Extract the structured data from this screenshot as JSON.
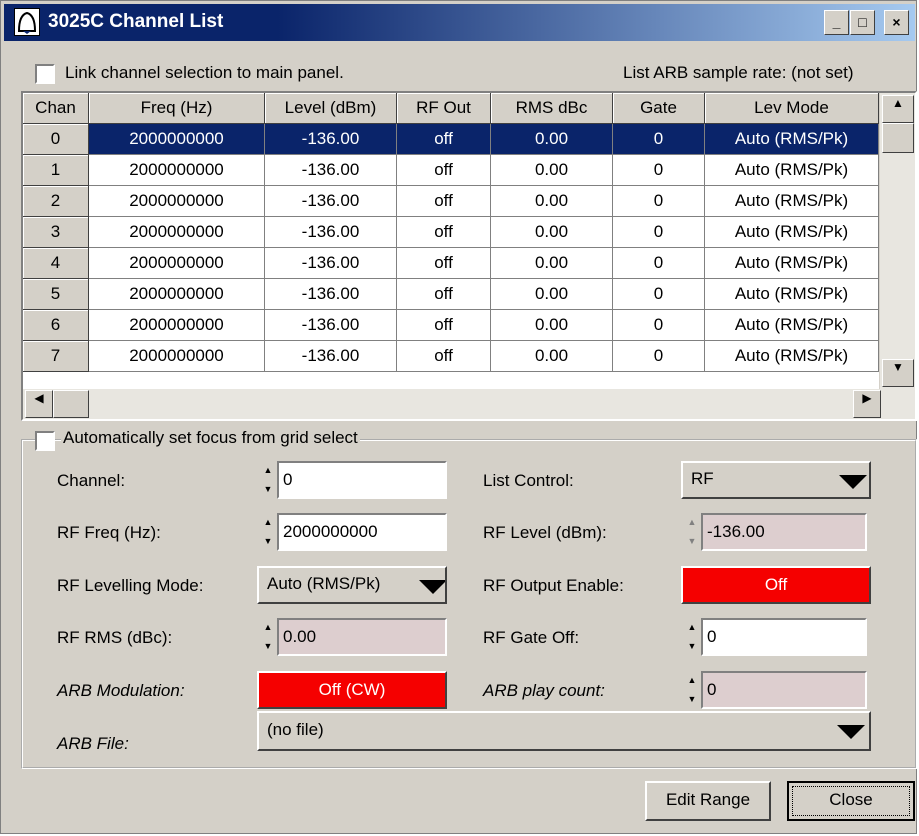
{
  "window": {
    "title": "3025C Channel List",
    "minimize_glyph": "_",
    "maximize_glyph": "□",
    "close_glyph": "×"
  },
  "top": {
    "link_label": "Link channel selection to main panel.",
    "link_checked": false,
    "arb_rate": "List ARB sample rate: (not set)"
  },
  "grid": {
    "columns": [
      "Chan",
      "Freq (Hz)",
      "Level (dBm)",
      "RF Out",
      "RMS dBc",
      "Gate",
      "Lev Mode"
    ],
    "selected_row": 0,
    "rows": [
      [
        "0",
        "2000000000",
        "-136.00",
        "off",
        "0.00",
        "0",
        "Auto (RMS/Pk)"
      ],
      [
        "1",
        "2000000000",
        "-136.00",
        "off",
        "0.00",
        "0",
        "Auto (RMS/Pk)"
      ],
      [
        "2",
        "2000000000",
        "-136.00",
        "off",
        "0.00",
        "0",
        "Auto (RMS/Pk)"
      ],
      [
        "3",
        "2000000000",
        "-136.00",
        "off",
        "0.00",
        "0",
        "Auto (RMS/Pk)"
      ],
      [
        "4",
        "2000000000",
        "-136.00",
        "off",
        "0.00",
        "0",
        "Auto (RMS/Pk)"
      ],
      [
        "5",
        "2000000000",
        "-136.00",
        "off",
        "0.00",
        "0",
        "Auto (RMS/Pk)"
      ],
      [
        "6",
        "2000000000",
        "-136.00",
        "off",
        "0.00",
        "0",
        "Auto (RMS/Pk)"
      ],
      [
        "7",
        "2000000000",
        "-136.00",
        "off",
        "0.00",
        "0",
        "Auto (RMS/Pk)"
      ]
    ]
  },
  "group": {
    "auto_focus_label": "Automatically set focus from grid select",
    "channel_label": "Channel:",
    "channel_value": "0",
    "rf_freq_label": "RF Freq (Hz):",
    "rf_freq_value": "2000000000",
    "lev_mode_label": "RF Levelling Mode:",
    "lev_mode_value": "Auto (RMS/Pk)",
    "rms_label": "RF RMS (dBc):",
    "rms_value": "0.00",
    "arb_mod_label": "ARB Modulation:",
    "arb_mod_value": "Off (CW)",
    "list_control_label": "List Control:",
    "list_control_value": "RF",
    "rf_level_label": "RF Level (dBm):",
    "rf_level_value": "-136.00",
    "rf_output_label": "RF Output Enable:",
    "rf_output_value": "Off",
    "gate_off_label": "RF Gate Off:",
    "gate_off_value": "0",
    "arb_count_label": "ARB play count:",
    "arb_count_value": "0",
    "arb_file_label": "ARB File:",
    "arb_file_value": "(no file)"
  },
  "buttons": {
    "edit_range": "Edit Range",
    "close": "Close"
  },
  "colors": {
    "title_blue": "#0a246a",
    "selected_row": "#0a246a",
    "alarm_red": "#f50000",
    "disabled_field": "#ddcecf"
  },
  "icons": [
    "app-bell-icon",
    "minimize-icon",
    "maximize-icon",
    "close-icon",
    "scroll-up-icon",
    "scroll-down-icon",
    "scroll-left-icon",
    "scroll-right-icon",
    "spin-icon",
    "dropdown-arrow-icon"
  ]
}
